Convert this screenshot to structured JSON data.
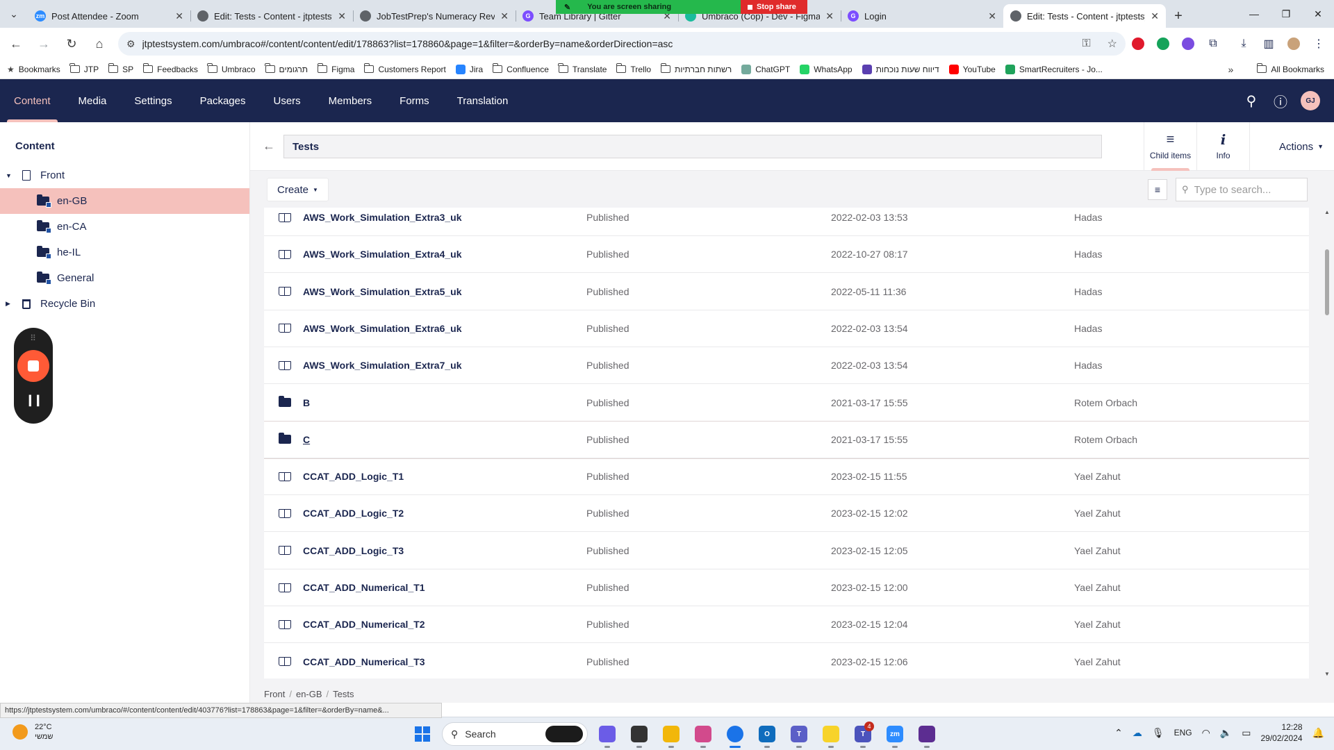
{
  "browser": {
    "tabs": [
      {
        "title": "Post Attendee - Zoom",
        "fav_color": "#2d8cff",
        "fav_text": "zm"
      },
      {
        "title": "Edit: Tests - Content - jtptestsystem",
        "fav_color": "#5f6368",
        "fav_text": ""
      },
      {
        "title": "JobTestPrep's Numeracy Review",
        "fav_color": "#5f6368",
        "fav_text": ""
      },
      {
        "title": "Team Library | Gitter",
        "fav_color": "#7c4dff",
        "fav_text": "G"
      },
      {
        "title": "Umbraco (Cop) - Dev - Figma",
        "fav_color": "#1abc9c",
        "fav_text": ""
      },
      {
        "title": "Login",
        "fav_color": "#7c4dff",
        "fav_text": "G"
      },
      {
        "title": "Edit: Tests - Content - jtptestsystem",
        "fav_color": "#5f6368",
        "fav_text": ""
      }
    ],
    "new_tab": "+",
    "url": "jtptestsystem.com/umbraco#/content/content/edit/178863?list=178860&page=1&filter=&orderBy=name&orderDirection=asc",
    "bookmarks": [
      {
        "label": "Bookmarks",
        "type": "star"
      },
      {
        "label": "JTP",
        "type": "folder"
      },
      {
        "label": "SP",
        "type": "folder"
      },
      {
        "label": "Feedbacks",
        "type": "folder"
      },
      {
        "label": "Umbraco",
        "type": "folder"
      },
      {
        "label": "תרגומים",
        "type": "folder"
      },
      {
        "label": "Figma",
        "type": "folder"
      },
      {
        "label": "Customers Report",
        "type": "folder"
      },
      {
        "label": "Jira",
        "type": "jira"
      },
      {
        "label": "Confluence",
        "type": "folder"
      },
      {
        "label": "Translate",
        "type": "folder"
      },
      {
        "label": "Trello",
        "type": "folder"
      },
      {
        "label": "רשתות חברתיות",
        "type": "folder"
      },
      {
        "label": "ChatGPT",
        "type": "chatgpt"
      },
      {
        "label": "WhatsApp",
        "type": "whatsapp"
      },
      {
        "label": "דיווח שעות נוכחות",
        "type": "hours"
      },
      {
        "label": "YouTube",
        "type": "youtube"
      },
      {
        "label": "SmartRecruiters - Jo...",
        "type": "smart"
      }
    ],
    "all_bookmarks": "All Bookmarks"
  },
  "screen_share": {
    "message": "You are screen sharing",
    "stop_label": "Stop share"
  },
  "umbraco": {
    "sections": [
      "Content",
      "Media",
      "Settings",
      "Packages",
      "Users",
      "Members",
      "Forms",
      "Translation"
    ],
    "active_section": "Content",
    "avatar_initials": "GJ"
  },
  "tree": {
    "title": "Content",
    "nodes": [
      {
        "label": "Front",
        "kind": "doc",
        "level": 0,
        "expanded": true
      },
      {
        "label": "en-GB",
        "kind": "folder",
        "level": 1,
        "selected": true
      },
      {
        "label": "en-CA",
        "kind": "folder",
        "level": 1
      },
      {
        "label": "he-IL",
        "kind": "folder",
        "level": 1
      },
      {
        "label": "General",
        "kind": "folder",
        "level": 1
      },
      {
        "label": "Recycle Bin",
        "kind": "bin",
        "level": 0,
        "expanded": false
      }
    ]
  },
  "editor": {
    "node_name": "Tests",
    "apps": [
      {
        "label": "Child items",
        "icon": "≡",
        "active": true
      },
      {
        "label": "Info",
        "icon": "i",
        "active": false
      }
    ],
    "actions_label": "Actions",
    "create_label": "Create",
    "search_placeholder": "Type to search...",
    "rows": [
      {
        "name": "AWS_Work_Simulation_Extra3_uk",
        "type": "doc",
        "status": "Published",
        "date": "2022-02-03 13:53",
        "owner": "Hadas"
      },
      {
        "name": "AWS_Work_Simulation_Extra4_uk",
        "type": "doc",
        "status": "Published",
        "date": "2022-10-27 08:17",
        "owner": "Hadas"
      },
      {
        "name": "AWS_Work_Simulation_Extra5_uk",
        "type": "doc",
        "status": "Published",
        "date": "2022-05-11 11:36",
        "owner": "Hadas"
      },
      {
        "name": "AWS_Work_Simulation_Extra6_uk",
        "type": "doc",
        "status": "Published",
        "date": "2022-02-03 13:54",
        "owner": "Hadas"
      },
      {
        "name": "AWS_Work_Simulation_Extra7_uk",
        "type": "doc",
        "status": "Published",
        "date": "2022-02-03 13:54",
        "owner": "Hadas"
      },
      {
        "name": "B",
        "type": "folder",
        "status": "Published",
        "date": "2021-03-17 15:55",
        "owner": "Rotem Orbach"
      },
      {
        "name": "C",
        "type": "folder",
        "status": "Published",
        "date": "2021-03-17 15:55",
        "owner": "Rotem Orbach",
        "hover": true
      },
      {
        "name": "CCAT_ADD_Logic_T1",
        "type": "doc",
        "status": "Published",
        "date": "2023-02-15 11:55",
        "owner": "Yael Zahut"
      },
      {
        "name": "CCAT_ADD_Logic_T2",
        "type": "doc",
        "status": "Published",
        "date": "2023-02-15 12:02",
        "owner": "Yael Zahut"
      },
      {
        "name": "CCAT_ADD_Logic_T3",
        "type": "doc",
        "status": "Published",
        "date": "2023-02-15 12:05",
        "owner": "Yael Zahut"
      },
      {
        "name": "CCAT_ADD_Numerical_T1",
        "type": "doc",
        "status": "Published",
        "date": "2023-02-15 12:00",
        "owner": "Yael Zahut"
      },
      {
        "name": "CCAT_ADD_Numerical_T2",
        "type": "doc",
        "status": "Published",
        "date": "2023-02-15 12:04",
        "owner": "Yael Zahut"
      },
      {
        "name": "CCAT_ADD_Numerical_T3",
        "type": "doc",
        "status": "Published",
        "date": "2023-02-15 12:06",
        "owner": "Yael Zahut"
      }
    ],
    "breadcrumb": [
      "Front",
      "en-GB",
      "Tests"
    ]
  },
  "status_url": "https://jtptestsystem.com/umbraco/#/content/content/edit/403776?list=178863&page=1&filter=&orderBy=name&...",
  "taskbar": {
    "weather_temp": "22°C",
    "weather_desc": "שמשי",
    "search_label": "Search",
    "apps": [
      {
        "name": "copilot",
        "color": "#6b5ce7",
        "label": ""
      },
      {
        "name": "file-viewer",
        "color": "#333333",
        "label": ""
      },
      {
        "name": "file-explorer",
        "color": "#f2b70a",
        "label": ""
      },
      {
        "name": "snipping-tool",
        "color": "#d24a8c",
        "label": ""
      },
      {
        "name": "chrome",
        "color": "#1a73e8",
        "label": "",
        "focused": true
      },
      {
        "name": "outlook",
        "color": "#0f6cbd",
        "label": "O"
      },
      {
        "name": "teams",
        "color": "#5b5fc7",
        "label": "T"
      },
      {
        "name": "sticky-notes",
        "color": "#f7d32a",
        "label": ""
      },
      {
        "name": "teams-new",
        "color": "#4b53bc",
        "label": "T",
        "badge": "4"
      },
      {
        "name": "zoom",
        "color": "#2d8cff",
        "label": "zm"
      },
      {
        "name": "recorder",
        "color": "#5c2d91",
        "label": ""
      }
    ],
    "language": "ENG",
    "time": "12:28",
    "date": "29/02/2024"
  }
}
